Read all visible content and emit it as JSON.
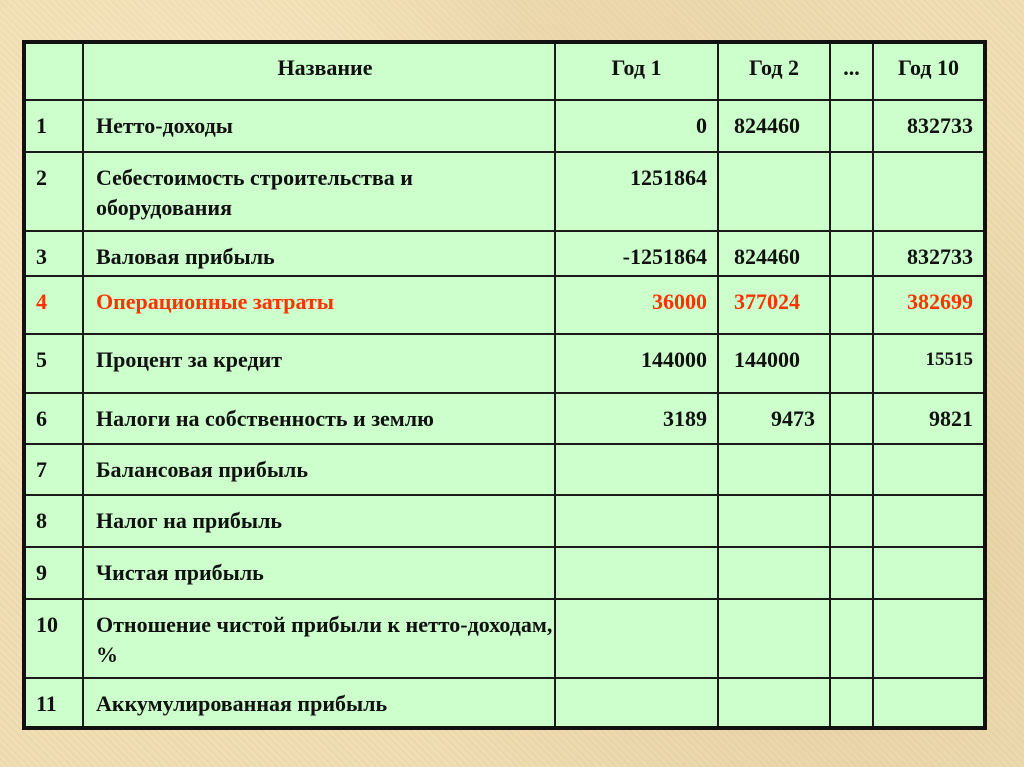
{
  "table": {
    "headers": {
      "num": "",
      "name": "Название",
      "year1": "Год 1",
      "year2": "Год 2",
      "dots": "...",
      "year10": "Год 10"
    },
    "rows": [
      {
        "num": "1",
        "name": "Нетто-доходы",
        "year1": "0",
        "year2": "824460",
        "dots": "",
        "year10": "832733"
      },
      {
        "num": "2",
        "name": "Себестоимость строительства и оборудования",
        "year1": "1251864",
        "year2": "",
        "dots": "",
        "year10": ""
      },
      {
        "num": "3",
        "name": "Валовая прибыль",
        "year1": "-1251864",
        "year2": "824460",
        "dots": "",
        "year10": "832733"
      },
      {
        "num": "4",
        "name": "Операционные затраты",
        "year1": "36000",
        "year2": "377024",
        "dots": "",
        "year10": "382699"
      },
      {
        "num": "5",
        "name": "Процент за кредит",
        "year1": "144000",
        "year2": "144000",
        "dots": "",
        "year10": "15515"
      },
      {
        "num": "6",
        "name": "Налоги на собственность и землю",
        "year1": "3189",
        "year2": "9473",
        "dots": "",
        "year10": "9821"
      },
      {
        "num": "7",
        "name": "Балансовая прибыль",
        "year1": "",
        "year2": "",
        "dots": "",
        "year10": ""
      },
      {
        "num": "8",
        "name": "Налог на прибыль",
        "year1": "",
        "year2": "",
        "dots": "",
        "year10": ""
      },
      {
        "num": "9",
        "name": "Чистая прибыль",
        "year1": "",
        "year2": "",
        "dots": "",
        "year10": ""
      },
      {
        "num": "10",
        "name": "Отношение чистой прибыли к нетто-доходам, %",
        "year1": "",
        "year2": "",
        "dots": "",
        "year10": ""
      },
      {
        "num": "11",
        "name": "Аккумулированная прибыль",
        "year1": "",
        "year2": "",
        "dots": "",
        "year10": ""
      }
    ]
  },
  "colors": {
    "table_bg": "#ccffcc",
    "highlight_text": "#ff3300",
    "text": "#111111",
    "page_bg": "#efdcb0"
  }
}
